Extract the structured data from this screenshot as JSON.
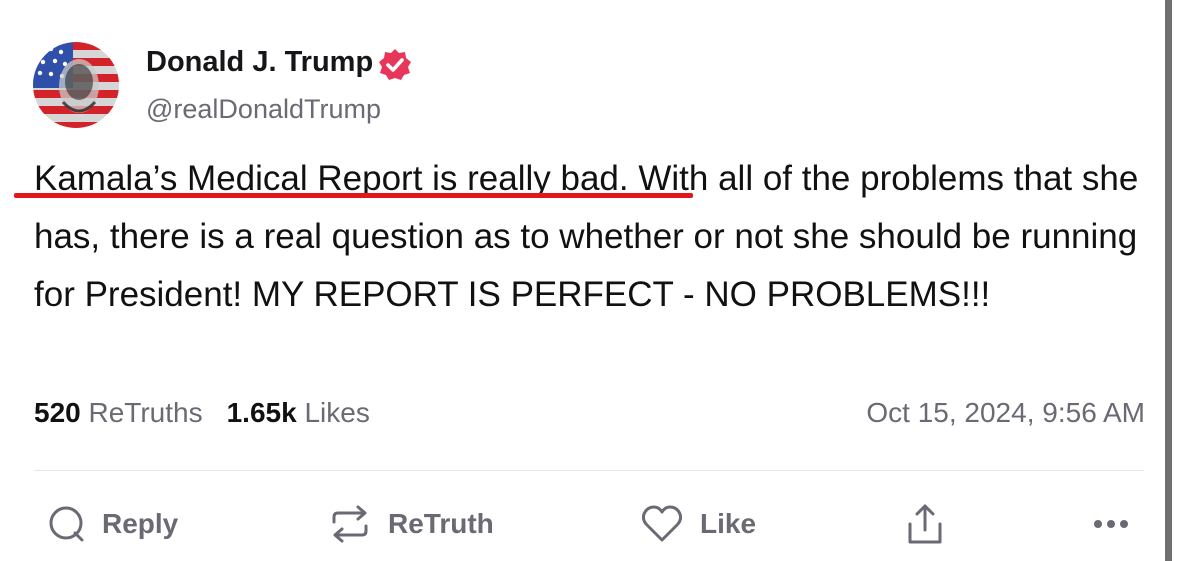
{
  "post": {
    "author_name": "Donald J. Trump",
    "handle": "@realDonaldTrump",
    "verified_icon": "verified-badge-icon",
    "text_highlighted": "Kamala’s Medical Report is really bad.",
    "text_rest": " With all of the problems that she has, there is a real question as to whether or not she should be running for President! MY REPORT IS PERFECT - NO PROBLEMS!!!",
    "retruths_count": "520",
    "retruths_label": "ReTruths",
    "likes_count": "1.65k",
    "likes_label": "Likes",
    "timestamp": "Oct 15, 2024, 9:56 AM"
  },
  "actions": {
    "reply_label": "Reply",
    "retruth_label": "ReTruth",
    "like_label": "Like",
    "icons": [
      "reply-icon",
      "retruth-icon",
      "like-icon",
      "share-icon",
      "more-icon"
    ]
  },
  "colors": {
    "underline": "#e3161c",
    "verified": "#e8365a",
    "muted": "#6a6a75"
  }
}
